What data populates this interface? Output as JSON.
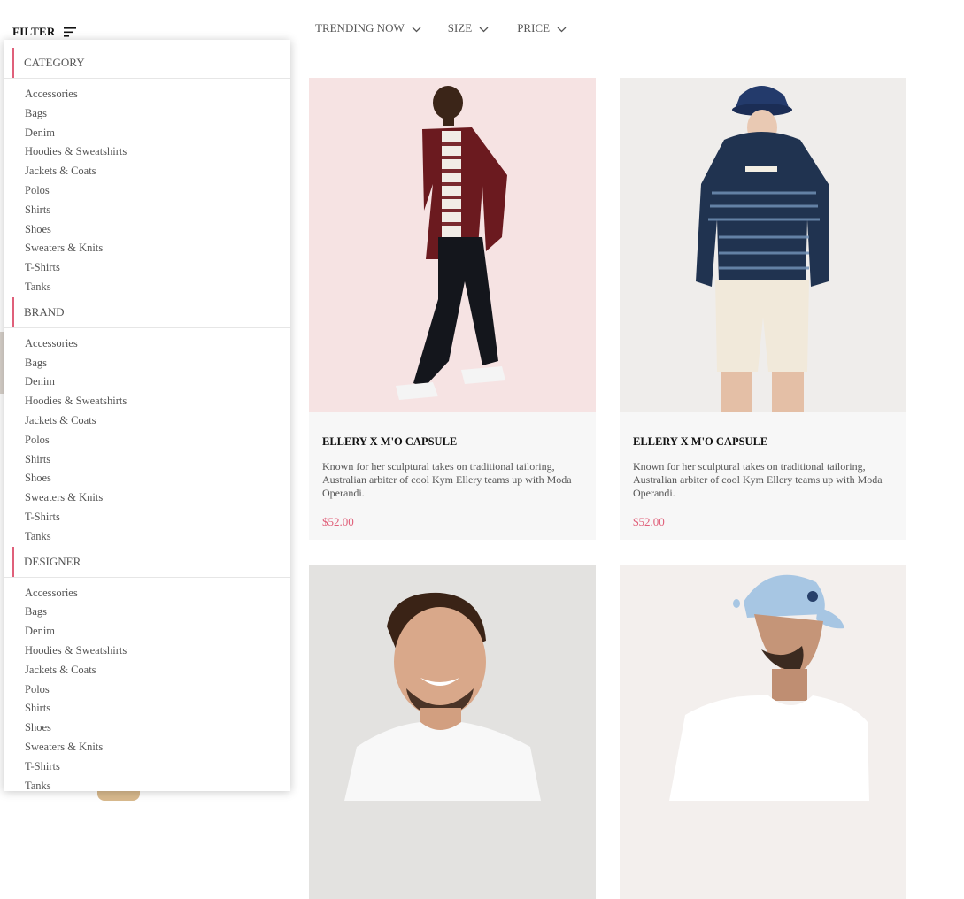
{
  "toolbar": {
    "filter_label": "FILTER",
    "sort_options": [
      "TRENDING NOW",
      "SIZE",
      "PRICE"
    ]
  },
  "filter_panel": {
    "sections": [
      {
        "title": "CATEGORY",
        "options": [
          "Accessories",
          "Bags",
          "Denim",
          "Hoodies & Sweatshirts",
          "Jackets & Coats",
          "Polos",
          "Shirts",
          "Shoes",
          "Sweaters & Knits",
          "T-Shirts",
          "Tanks"
        ]
      },
      {
        "title": "BRAND",
        "options": [
          "Accessories",
          "Bags",
          "Denim",
          "Hoodies & Sweatshirts",
          "Jackets & Coats",
          "Polos",
          "Shirts",
          "Shoes",
          "Sweaters & Knits",
          "T-Shirts",
          "Tanks"
        ]
      },
      {
        "title": "DESIGNER",
        "options": [
          "Accessories",
          "Bags",
          "Denim",
          "Hoodies & Sweatshirts",
          "Jackets & Coats",
          "Polos",
          "Shirts",
          "Shoes",
          "Sweaters & Knits",
          "T-Shirts",
          "Tanks"
        ]
      }
    ]
  },
  "products": [
    {
      "title": "ELLERY X M'O CAPSULE",
      "description": "Known for her sculptural takes on traditional tailoring, Australian arbiter of cool Kym Ellery teams up with Moda Operandi.",
      "price": "$52.00",
      "image_bg": "#f6e3e3"
    },
    {
      "title": "ELLERY X M'O CAPSULE",
      "description": "Known for her sculptural takes on traditional tailoring, Australian arbiter of cool Kym Ellery teams up with Moda Operandi.",
      "price": "$52.00",
      "image_bg": "#efedeb"
    },
    {
      "image_bg": "#e3e2e0"
    },
    {
      "image_bg": "#f3efed"
    }
  ],
  "colors": {
    "accent": "#e0607a",
    "card_body": "#f7f7f7"
  }
}
